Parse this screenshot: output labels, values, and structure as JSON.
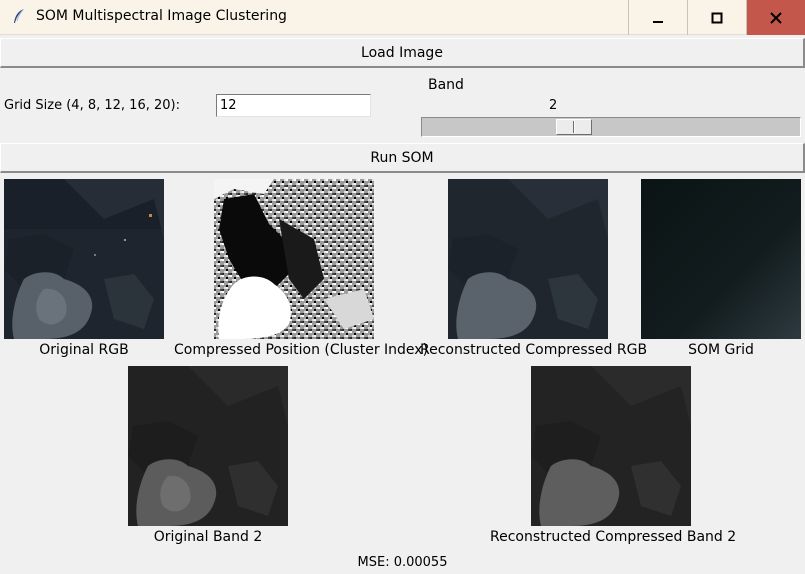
{
  "window": {
    "title": "SOM Multispectral Image Clustering",
    "icon": "feather-icon",
    "controls": {
      "minimize": "minimize-icon",
      "maximize": "maximize-icon",
      "close": "close-icon"
    }
  },
  "toolbar": {
    "load_label": "Load Image",
    "run_label": "Run SOM"
  },
  "grid": {
    "label": "Grid Size (4, 8, 12, 16, 20):",
    "value": "12"
  },
  "band": {
    "label": "Band",
    "value": "2",
    "slider_position": 0.355
  },
  "images": {
    "original_rgb": "Original RGB",
    "cluster_index": "Compressed Position (Cluster Index)",
    "reconstructed_rgb": "Reconstructed Compressed RGB",
    "som_grid": "SOM Grid",
    "original_band": "Original Band 2",
    "reconstructed_band": "Reconstructed Compressed Band 2"
  },
  "status": {
    "mse": "MSE: 0.00055"
  },
  "colors": {
    "titlebar": "#faf4e8",
    "close_button": "#c4574c",
    "background": "#f0f0f0"
  }
}
